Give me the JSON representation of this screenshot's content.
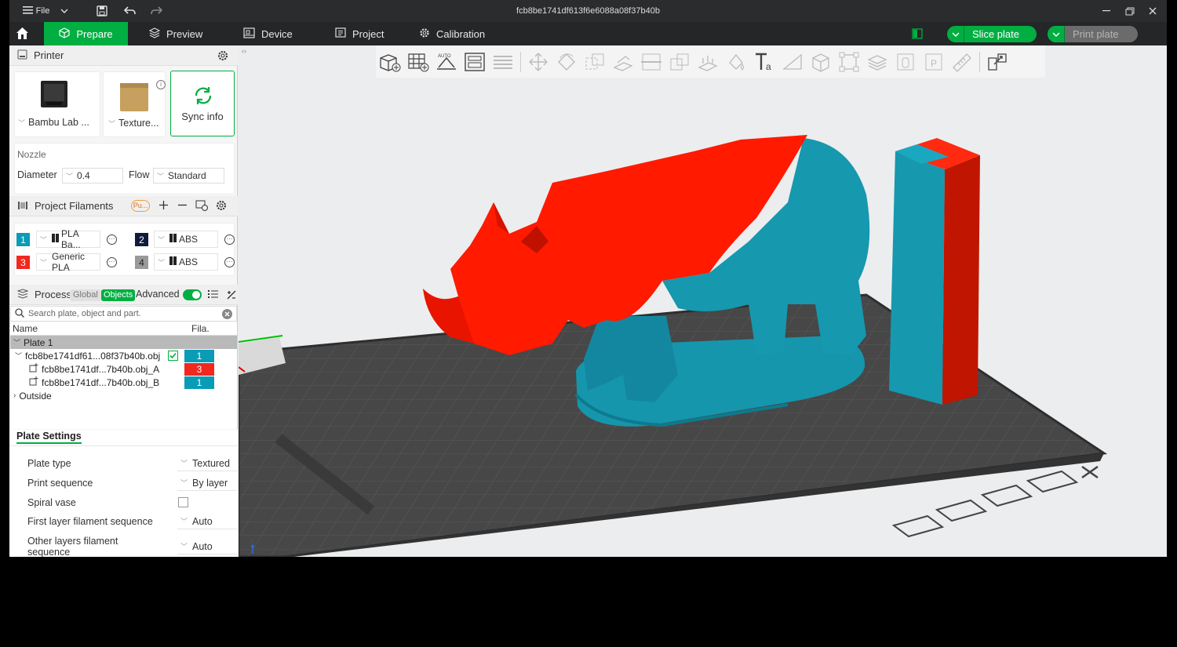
{
  "window": {
    "title": "fcb8be1741df613f6e6088a08f37b40b",
    "menu_label": "File"
  },
  "nav": {
    "tabs": [
      {
        "label": "Prepare"
      },
      {
        "label": "Preview"
      },
      {
        "label": "Device"
      },
      {
        "label": "Project"
      },
      {
        "label": "Calibration"
      }
    ],
    "slice_label": "Slice plate",
    "print_label": "Print plate"
  },
  "printer": {
    "section_title": "Printer",
    "printer_name": "Bambu Lab ...",
    "plate_name": "Texture...",
    "sync_label": "Sync info",
    "nozzle_label": "Nozzle",
    "diameter_label": "Diameter",
    "diameter_value": "0.4",
    "flow_label": "Flow",
    "flow_value": "Standard"
  },
  "filaments": {
    "section_title": "Project Filaments",
    "badge": "Pu...",
    "items": [
      {
        "num": "1",
        "name": "PLA Ba...",
        "color": "#0a9bb7"
      },
      {
        "num": "2",
        "name": "ABS",
        "color": "#101a3a"
      },
      {
        "num": "3",
        "name": "Generic PLA",
        "color": "#f0281e"
      },
      {
        "num": "4",
        "name": "ABS",
        "color": "#9a9a9a"
      }
    ]
  },
  "process": {
    "section_title": "Process",
    "global_label": "Global",
    "objects_label": "Objects",
    "advanced_label": "Advanced",
    "search_placeholder": "Search plate, object and part.",
    "col_name": "Name",
    "col_fila": "Fila.",
    "tree": {
      "plate": "Plate 1",
      "object": "fcb8be1741df61...08f37b40b.obj",
      "object_fila": "1",
      "part_a": "fcb8be1741df...7b40b.obj_A",
      "part_a_fila": "3",
      "part_b": "fcb8be1741df...7b40b.obj_B",
      "part_b_fila": "1",
      "outside": "Outside"
    }
  },
  "plate_settings": {
    "title": "Plate Settings",
    "rows": [
      {
        "label": "Plate type",
        "value": "Textured"
      },
      {
        "label": "Print sequence",
        "value": "By layer"
      },
      {
        "label": "Spiral vase",
        "value": ""
      },
      {
        "label": "First layer filament sequence",
        "value": "Auto"
      },
      {
        "label": "Other layers filament sequence",
        "value": "Auto"
      }
    ]
  },
  "colors": {
    "accent": "#00ae42",
    "model_red": "#ff1a00",
    "model_teal": "#1596ad"
  }
}
